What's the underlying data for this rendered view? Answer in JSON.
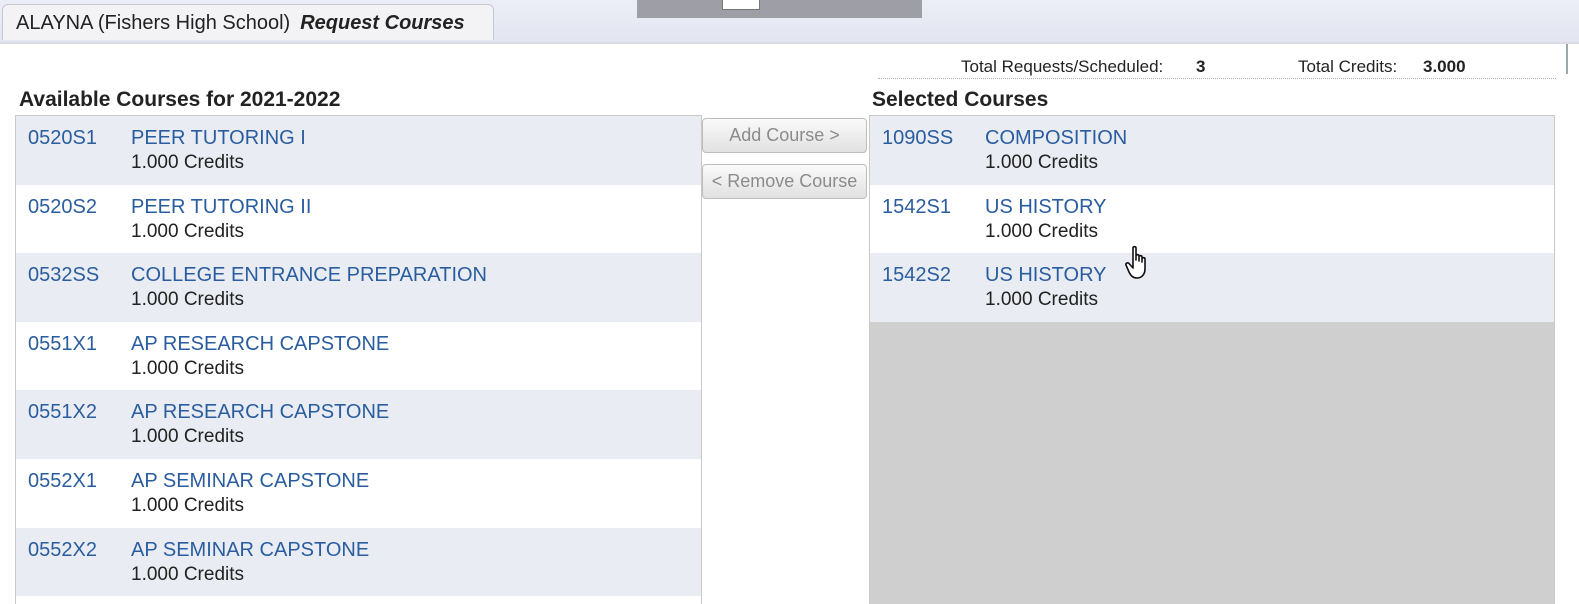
{
  "tab": {
    "student": "ALAYNA (Fishers High School)",
    "title": "Request Courses"
  },
  "totals": {
    "requests_label": "Total Requests/Scheduled:",
    "requests_value": "3",
    "credits_label": "Total Credits:",
    "credits_value": "3.000"
  },
  "available": {
    "title": "Available Courses for 2021-2022",
    "courses": [
      {
        "code": "0520S1",
        "name": "PEER TUTORING I",
        "credits": "1.000 Credits"
      },
      {
        "code": "0520S2",
        "name": "PEER TUTORING II",
        "credits": "1.000 Credits"
      },
      {
        "code": "0532SS",
        "name": "COLLEGE ENTRANCE PREPARATION",
        "credits": "1.000 Credits"
      },
      {
        "code": "0551X1",
        "name": "AP RESEARCH CAPSTONE",
        "credits": "1.000 Credits"
      },
      {
        "code": "0551X2",
        "name": "AP RESEARCH CAPSTONE",
        "credits": "1.000 Credits"
      },
      {
        "code": "0552X1",
        "name": "AP SEMINAR CAPSTONE",
        "credits": "1.000 Credits"
      },
      {
        "code": "0552X2",
        "name": "AP SEMINAR CAPSTONE",
        "credits": "1.000 Credits"
      }
    ]
  },
  "buttons": {
    "add": "Add Course >",
    "remove": "< Remove Course"
  },
  "selected": {
    "title": "Selected Courses",
    "courses": [
      {
        "code": "1090SS",
        "name": "COMPOSITION",
        "credits": "1.000 Credits"
      },
      {
        "code": "1542S1",
        "name": "US HISTORY",
        "credits": "1.000 Credits"
      },
      {
        "code": "1542S2",
        "name": "US HISTORY",
        "credits": "1.000 Credits"
      }
    ]
  },
  "colors": {
    "link": "#2a5d9f",
    "row_alt": "#e9ecf2",
    "empty_area": "#cfcfcf"
  },
  "icons": {
    "cursor": "hand-pointer-icon"
  }
}
